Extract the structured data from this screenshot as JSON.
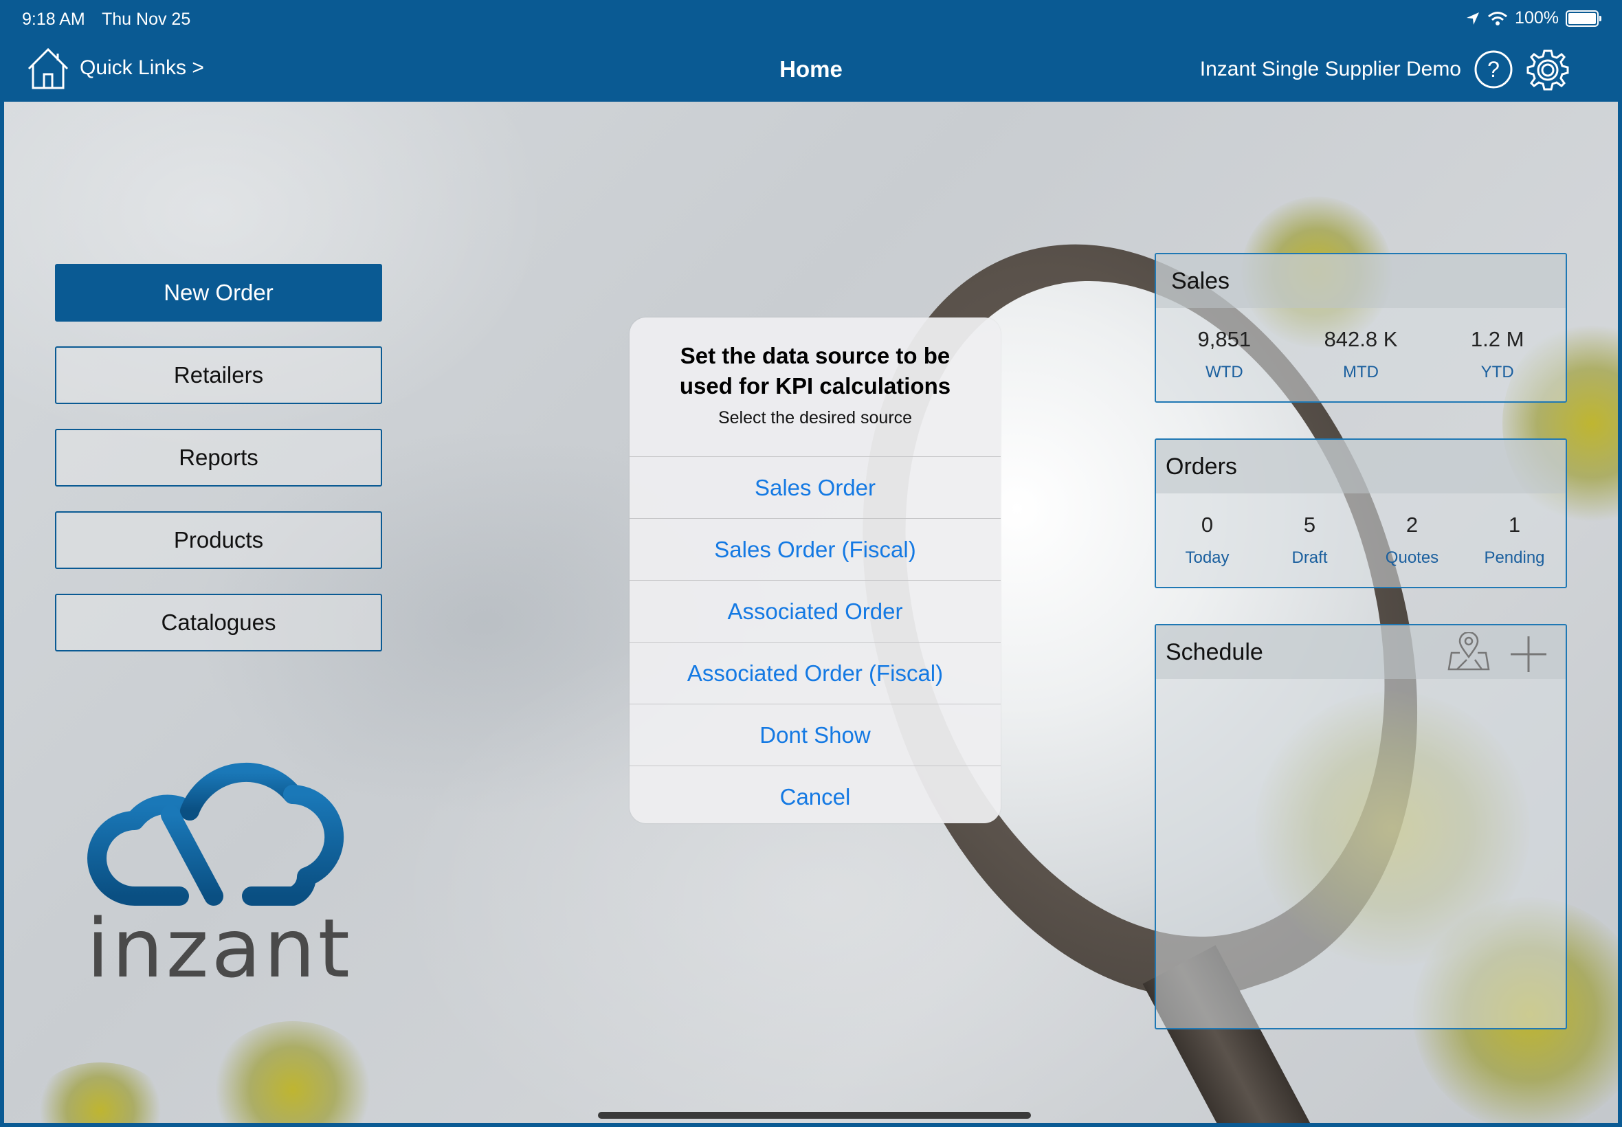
{
  "status_bar": {
    "time": "9:18 AM",
    "date": "Thu Nov 25",
    "battery": "100%"
  },
  "nav": {
    "quick_links": "Quick Links >",
    "title": "Home",
    "company": "Inzant Single Supplier Demo",
    "help_icon": "?"
  },
  "menu": {
    "new_order": "New Order",
    "retailers": "Retailers",
    "reports": "Reports",
    "products": "Products",
    "catalogues": "Catalogues"
  },
  "logo": {
    "text": "inzant"
  },
  "sales": {
    "title": "Sales",
    "items": [
      {
        "value": "9,851",
        "label": "WTD"
      },
      {
        "value": "842.8 K",
        "label": "MTD"
      },
      {
        "value": "1.2 M",
        "label": "YTD"
      }
    ]
  },
  "orders": {
    "title": "Orders",
    "items": [
      {
        "value": "0",
        "label": "Today"
      },
      {
        "value": "5",
        "label": "Draft"
      },
      {
        "value": "2",
        "label": "Quotes"
      },
      {
        "value": "1",
        "label": "Pending"
      }
    ]
  },
  "schedule": {
    "title": "Schedule"
  },
  "dialog": {
    "title": "Set the data source to be used for KPI calculations",
    "subtitle": "Select the desired source",
    "options": [
      "Sales Order",
      "Sales Order (Fiscal)",
      "Associated Order",
      "Associated Order (Fiscal)",
      "Dont Show",
      "Cancel"
    ]
  },
  "colors": {
    "brand": "#0a5a93",
    "link": "#1479e3",
    "kpi_label": "#1a5f9e"
  }
}
